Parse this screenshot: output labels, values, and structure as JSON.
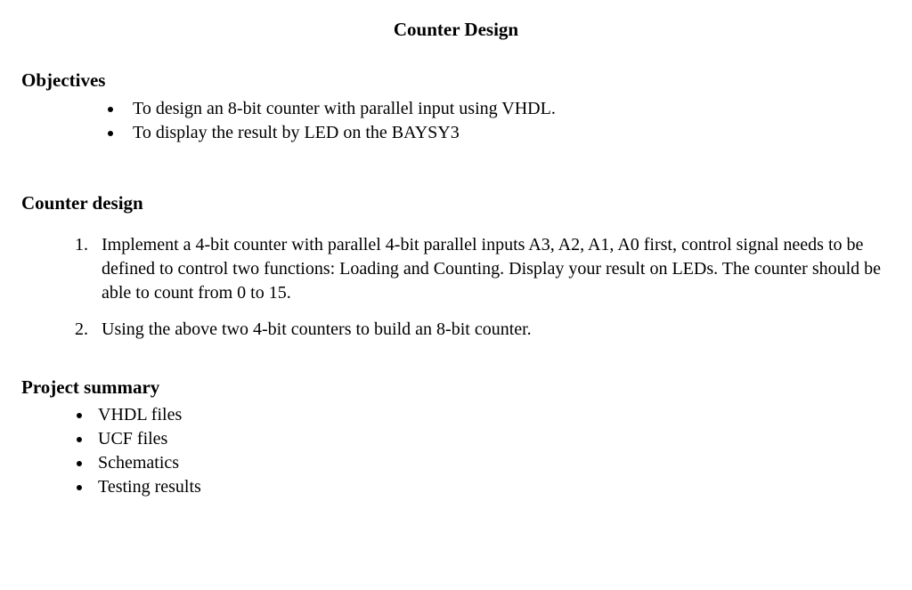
{
  "title": "Counter Design",
  "objectives": {
    "heading": "Objectives",
    "items": [
      "To design an 8-bit counter with parallel input using VHDL.",
      "To display the result by LED on the BAYSY3"
    ]
  },
  "counter_design": {
    "heading": "Counter design",
    "items": [
      "Implement a 4-bit counter with parallel 4-bit parallel inputs A3, A2, A1, A0 first, control signal needs to be defined to control two functions: Loading and Counting.  Display your result on LEDs. The counter should be able to count from 0 to 15.",
      "Using the above two 4-bit counters to build an 8-bit counter."
    ]
  },
  "project_summary": {
    "heading": "Project summary",
    "items": [
      "VHDL files",
      "UCF files",
      "Schematics",
      "Testing results"
    ]
  }
}
